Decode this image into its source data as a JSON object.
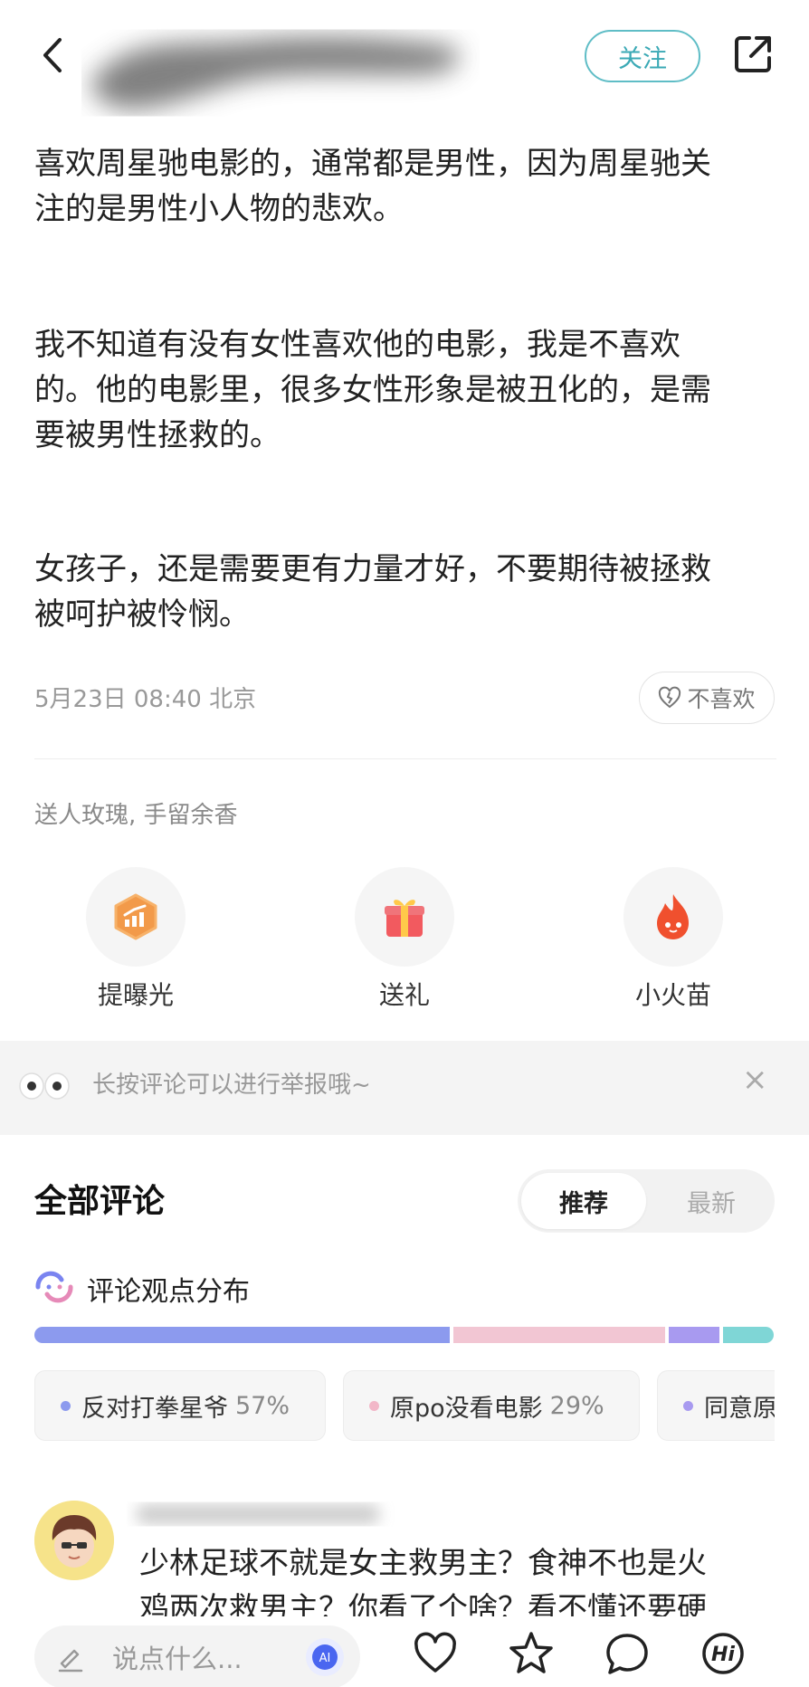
{
  "header": {
    "follow_label": "关注"
  },
  "post": {
    "paragraphs": [
      "喜欢周星驰电影的，通常都是男性，因为周星驰关\n注的是男性小人物的悲欢。",
      "我不知道有没有女性喜欢他的电影，我是不喜欢\n的。他的电影里，很多女性形象是被丑化的，是需\n要被男性拯救的。",
      "女孩子，还是需要更有力量才好，不要期待被拯救\n被呵护被怜悯。"
    ],
    "time": "5月23日 08:40 北京",
    "dislike_label": "不喜欢"
  },
  "gift": {
    "caption": "送人玫瑰, 手留余香",
    "actions": [
      {
        "label": "提曝光",
        "icon": "boost-exposure-icon"
      },
      {
        "label": "送礼",
        "icon": "gift-icon"
      },
      {
        "label": "小火苗",
        "icon": "flame-icon"
      }
    ]
  },
  "notice": {
    "text": "长按评论可以进行举报哦~",
    "close": "×"
  },
  "comments": {
    "title": "全部评论",
    "sort_tabs": [
      "推荐",
      "最新"
    ],
    "active_sort": "推荐",
    "opinion_title": "评论观点分布",
    "opinions": [
      {
        "label": "反对打拳星爷",
        "percent": "57%",
        "color": "#8c9aee",
        "share": 0.57
      },
      {
        "label": "原po没看电影",
        "percent": "29%",
        "color": "#f2c6d3",
        "share": 0.29
      },
      {
        "label": "同意原",
        "percent": "",
        "color": "#a89af0",
        "share": 0.07
      },
      {
        "label": "",
        "percent": "",
        "color": "#7fd6d6",
        "share": 0.07
      }
    ],
    "items": [
      {
        "text": "少林足球不就是女主救男主？食神不也是火\n鸡两次救男主？你看了个啥？看不懂还要硬"
      }
    ]
  },
  "bottom_bar": {
    "input_placeholder": "说点什么...",
    "icons": [
      "heart-icon",
      "star-icon",
      "comment-icon",
      "hi-icon"
    ]
  }
}
